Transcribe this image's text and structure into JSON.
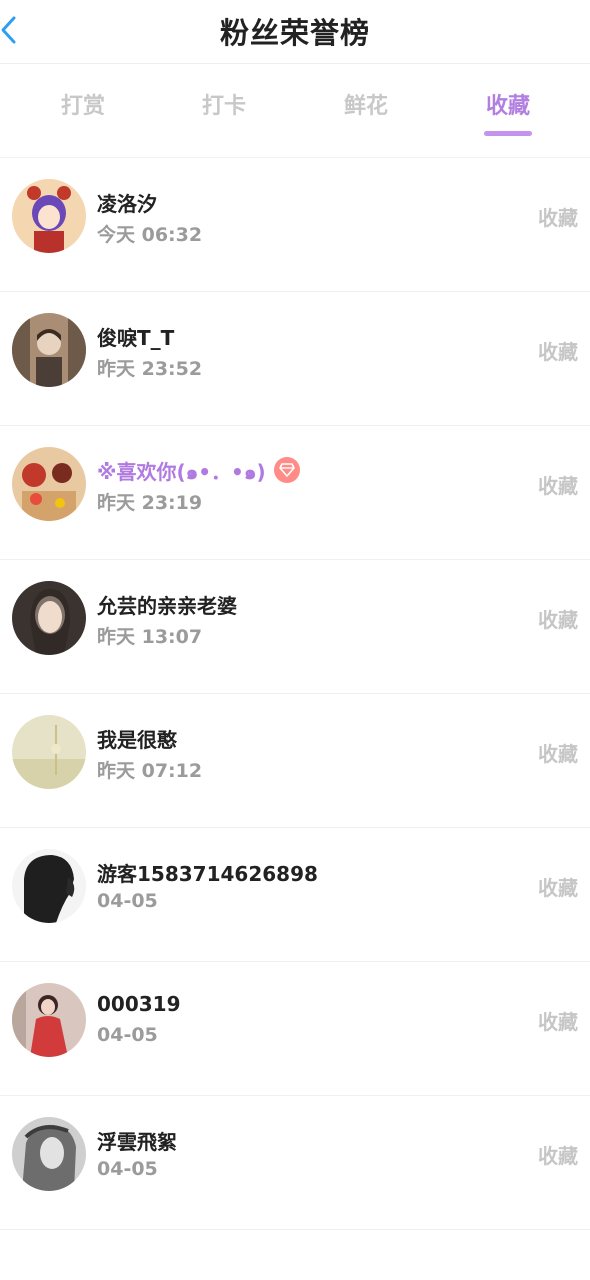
{
  "header": {
    "title": "粉丝荣誉榜",
    "back_icon": "chevron-left-icon"
  },
  "colors": {
    "accent": "#b17fe0",
    "tab_inactive": "#c8c8c8",
    "action": "#c6c6c6",
    "time": "#9b9b9b",
    "badge": "#ff8c86"
  },
  "tabs": [
    {
      "label": "打赏",
      "active": false
    },
    {
      "label": "打卡",
      "active": false
    },
    {
      "label": "鲜花",
      "active": false
    },
    {
      "label": "收藏",
      "active": true
    }
  ],
  "list": [
    {
      "name": "凌洛汐",
      "time": "今天 06:32",
      "action": "收藏"
    },
    {
      "name": "俊唳T_T",
      "time": "昨天 23:52",
      "action": "收藏"
    },
    {
      "name": "※喜欢你(๑•．•๑)",
      "time": "昨天 23:19",
      "action": "收藏",
      "highlight": true,
      "badge_icon": "diamond-icon"
    },
    {
      "name": "允芸的亲亲老婆",
      "time": "昨天 13:07",
      "action": "收藏"
    },
    {
      "name": "我是很憨",
      "time": "昨天 07:12",
      "action": "收藏"
    },
    {
      "name": "游客1583714626898",
      "time": "04-05",
      "action": "收藏"
    },
    {
      "name": "000319",
      "time": "04-05",
      "action": "收藏"
    },
    {
      "name": "浮雲飛絮",
      "time": "04-05",
      "action": "收藏"
    }
  ]
}
